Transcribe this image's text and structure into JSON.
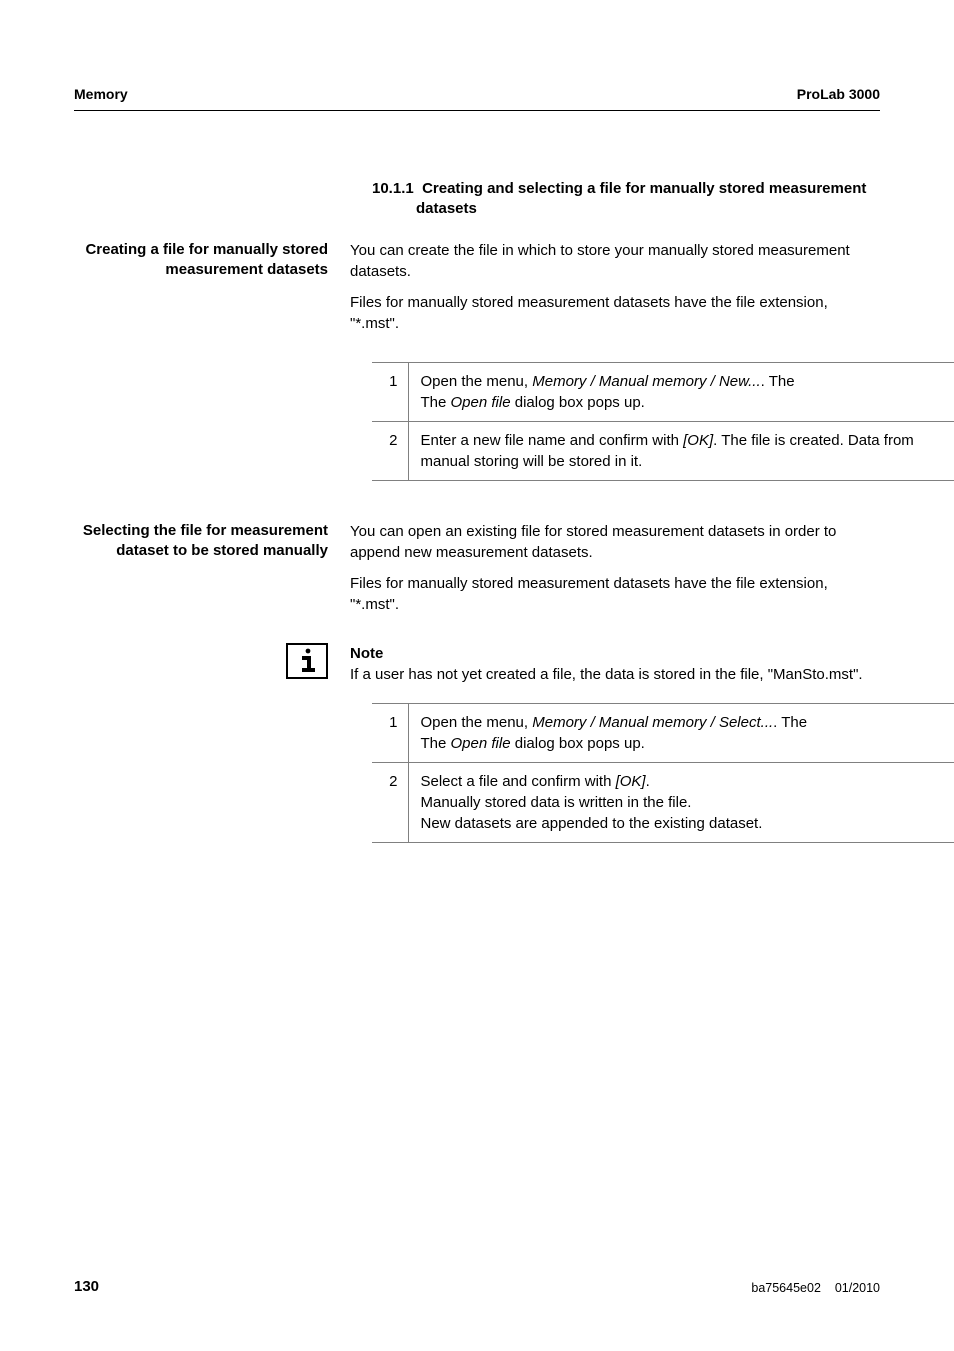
{
  "header": {
    "left": "Memory",
    "right": "ProLab 3000"
  },
  "section": {
    "number": "10.1.1",
    "title": "Creating and selecting a file for manually stored measurement datasets"
  },
  "block1": {
    "sideLabel": "Creating a file for manually stored measurement datasets",
    "para1": "You can create the file in which to store your manually stored measurement datasets.",
    "para2": "Files for manually stored measurement datasets have the file extension, \"*.mst\"."
  },
  "steps1": [
    {
      "num": "1",
      "prefix": "Open the menu, ",
      "menuPath": "Memory / Manual memory / New...",
      "suffix": ". The ",
      "dialogName": "Open file",
      "tail": " dialog box pops up."
    },
    {
      "num": "2",
      "prefix": "Enter a new file name and confirm with ",
      "key": "[OK]",
      "suffix": ". The file is created. Data from manual storing will be stored in it."
    }
  ],
  "block2": {
    "sideLabel": "Selecting the file for measurement dataset to be stored manually",
    "para1": "You can open an existing file for stored measurement datasets in order to append new measurement datasets.",
    "para2": "Files for manually stored measurement datasets have the file extension, \"*.mst\"."
  },
  "note": {
    "title": "Note",
    "text": "If a user has not yet created a file, the data is stored in the file, \"ManSto.mst\"."
  },
  "steps2": [
    {
      "num": "1",
      "prefix": "Open the menu, ",
      "menuPath": "Memory / Manual memory / Select...",
      "suffix": ". The ",
      "dialogName": "Open file",
      "tail": " dialog box pops up."
    },
    {
      "num": "2",
      "prefix": "Select a file and confirm with ",
      "key": "[OK]",
      "line2": "Manually stored data is written in the file.",
      "line3": "New datasets are appended to the existing dataset."
    }
  ],
  "footer": {
    "pageNum": "130",
    "docRef": "ba75645e02",
    "date": "01/2010"
  }
}
